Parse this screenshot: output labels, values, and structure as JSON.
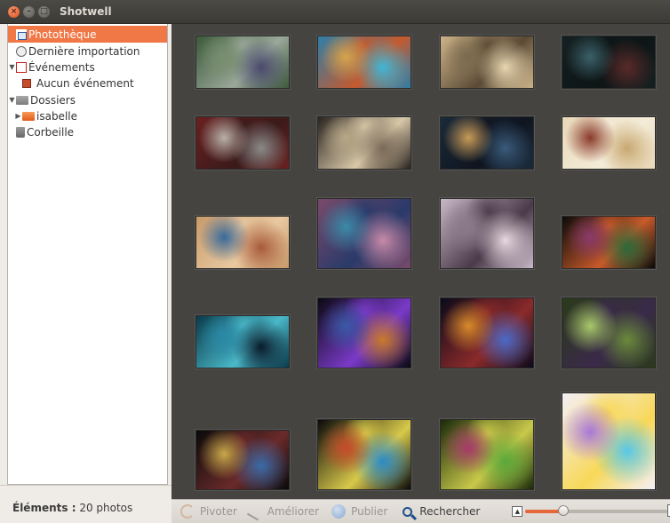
{
  "window": {
    "title": "Shotwell"
  },
  "sidebar": {
    "items": [
      {
        "label": "Photothèque",
        "icon": "photo-library-icon",
        "selected": true
      },
      {
        "label": "Dernière importation",
        "icon": "last-import-icon"
      },
      {
        "label": "Événements",
        "icon": "events-icon",
        "expanded": true
      },
      {
        "label": "Aucun événement",
        "icon": "no-event-icon"
      },
      {
        "label": "Dossiers",
        "icon": "folder-icon",
        "expanded": true
      },
      {
        "label": "isabelle",
        "icon": "user-folder-icon",
        "expanded": false
      },
      {
        "label": "Corbeille",
        "icon": "trash-icon"
      }
    ]
  },
  "status": {
    "label": "Éléments :",
    "value": "20 photos"
  },
  "toolbar": {
    "rotate_label": "Pivoter",
    "enhance_label": "Améliorer",
    "publish_label": "Publier",
    "search_label": "Rechercher",
    "zoom_level": 0.27
  },
  "colors": {
    "accent": "#f07746",
    "background": "#454440",
    "sidebar": "#ffffff"
  },
  "photos": [
    {
      "name": "photo-1",
      "colors": [
        "#3c5a3a",
        "#7a8f6f",
        "#4a4a6e",
        "#9aa89a"
      ]
    },
    {
      "name": "photo-2",
      "colors": [
        "#2e7ea8",
        "#d8a34b",
        "#3fb6d6",
        "#c55a2e"
      ]
    },
    {
      "name": "photo-3",
      "colors": [
        "#cdb389",
        "#7a6a4d",
        "#e8d6b0",
        "#5a4a35"
      ]
    },
    {
      "name": "photo-4",
      "colors": [
        "#152022",
        "#3a6068",
        "#5a2a2a",
        "#0d1515"
      ]
    },
    {
      "name": "photo-5",
      "colors": [
        "#6a2020",
        "#b8b0a8",
        "#8a8a88",
        "#3a1a1a"
      ]
    },
    {
      "name": "photo-6",
      "colors": [
        "#2a2420",
        "#b8a888",
        "#7a6a58",
        "#d8c8a8"
      ]
    },
    {
      "name": "photo-7",
      "colors": [
        "#1a2a3a",
        "#c89a58",
        "#3a5a7a",
        "#0f1520"
      ]
    },
    {
      "name": "photo-8",
      "colors": [
        "#e8d8b8",
        "#8a3a2a",
        "#c8a870",
        "#f4ecd8"
      ]
    },
    {
      "name": "photo-9",
      "colors": [
        "#c89a6a",
        "#3a6a9a",
        "#a85a3a",
        "#e8c8a0"
      ]
    },
    {
      "name": "photo-10",
      "colors": [
        "#7a4a6a",
        "#3a8aa8",
        "#c88aa8",
        "#2a3a6a"
      ]
    },
    {
      "name": "photo-11",
      "colors": [
        "#c8b8c8",
        "#8a7a8a",
        "#e8d8e0",
        "#4a3a4a"
      ]
    },
    {
      "name": "photo-12",
      "colors": [
        "#0a0a0a",
        "#8a3a6a",
        "#2a6a3a",
        "#c85a2a"
      ]
    },
    {
      "name": "photo-13",
      "colors": [
        "#0a3a4a",
        "#2a8aa8",
        "#0a1a2a",
        "#4ab8c8"
      ]
    },
    {
      "name": "photo-14",
      "colors": [
        "#0a0a12",
        "#3a5aa8",
        "#c87a2a",
        "#7a3ac8"
      ]
    },
    {
      "name": "photo-15",
      "colors": [
        "#0a0a1a",
        "#d88a2a",
        "#4a6ac8",
        "#8a2a2a"
      ]
    },
    {
      "name": "photo-16",
      "colors": [
        "#2a3a1a",
        "#a8c86a",
        "#6a8a3a",
        "#3a2a4a"
      ]
    },
    {
      "name": "photo-17",
      "colors": [
        "#0a0a0a",
        "#c8a84a",
        "#3a6aa8",
        "#6a2a2a"
      ]
    },
    {
      "name": "photo-18",
      "colors": [
        "#0a0a0a",
        "#c84a2a",
        "#2a8ac8",
        "#d8c84a"
      ]
    },
    {
      "name": "photo-19",
      "colors": [
        "#1a2a0a",
        "#a83a6a",
        "#5aa83a",
        "#c8c84a"
      ]
    },
    {
      "name": "photo-20",
      "colors": [
        "#f4f0f8",
        "#a878d8",
        "#58c8e8",
        "#f8d858"
      ]
    }
  ]
}
